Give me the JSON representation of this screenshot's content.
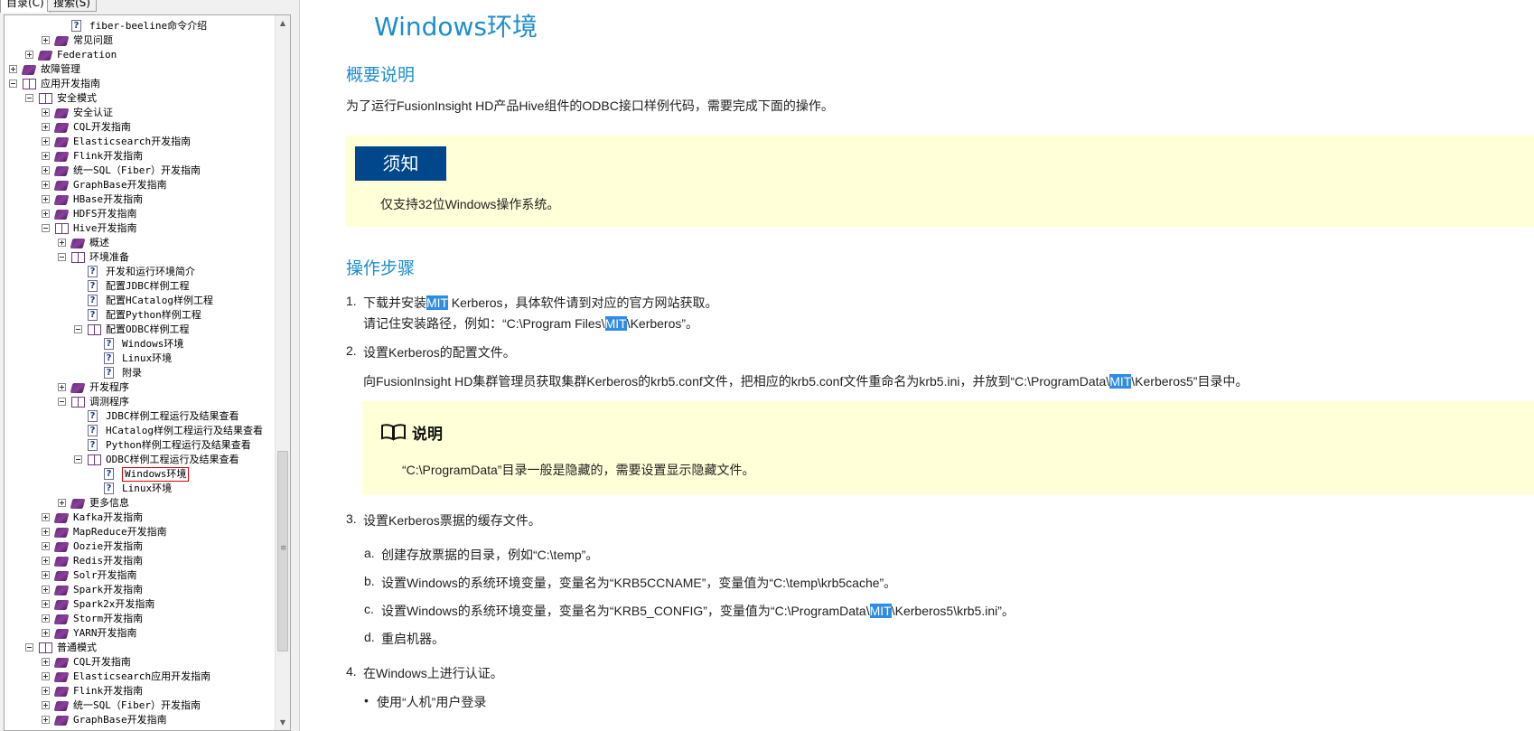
{
  "tabs": {
    "contents": "目录(C)",
    "search": "搜索(S)"
  },
  "tree": [
    {
      "label": "fiber-beeline命令介绍",
      "level": 3,
      "icon": "page",
      "exp": ""
    },
    {
      "label": "常见问题",
      "level": 2,
      "icon": "book",
      "exp": "plus"
    },
    {
      "label": "Federation",
      "level": 1,
      "icon": "book",
      "exp": "plus"
    },
    {
      "label": "故障管理",
      "level": 0,
      "icon": "book",
      "exp": "plus"
    },
    {
      "label": "应用开发指南",
      "level": 0,
      "icon": "book-open",
      "exp": "minus"
    },
    {
      "label": "安全模式",
      "level": 1,
      "icon": "book-open",
      "exp": "minus"
    },
    {
      "label": "安全认证",
      "level": 2,
      "icon": "book",
      "exp": "plus"
    },
    {
      "label": "CQL开发指南",
      "level": 2,
      "icon": "book",
      "exp": "plus"
    },
    {
      "label": "Elasticsearch开发指南",
      "level": 2,
      "icon": "book",
      "exp": "plus"
    },
    {
      "label": "Flink开发指南",
      "level": 2,
      "icon": "book",
      "exp": "plus"
    },
    {
      "label": "统一SQL（Fiber）开发指南",
      "level": 2,
      "icon": "book",
      "exp": "plus"
    },
    {
      "label": "GraphBase开发指南",
      "level": 2,
      "icon": "book",
      "exp": "plus"
    },
    {
      "label": "HBase开发指南",
      "level": 2,
      "icon": "book",
      "exp": "plus"
    },
    {
      "label": "HDFS开发指南",
      "level": 2,
      "icon": "book",
      "exp": "plus"
    },
    {
      "label": "Hive开发指南",
      "level": 2,
      "icon": "book-open",
      "exp": "minus"
    },
    {
      "label": "概述",
      "level": 3,
      "icon": "book",
      "exp": "plus"
    },
    {
      "label": "环境准备",
      "level": 3,
      "icon": "book-open",
      "exp": "minus"
    },
    {
      "label": "开发和运行环境简介",
      "level": 4,
      "icon": "page",
      "exp": ""
    },
    {
      "label": "配置JDBC样例工程",
      "level": 4,
      "icon": "page",
      "exp": ""
    },
    {
      "label": "配置HCatalog样例工程",
      "level": 4,
      "icon": "page",
      "exp": ""
    },
    {
      "label": "配置Python样例工程",
      "level": 4,
      "icon": "page",
      "exp": ""
    },
    {
      "label": "配置ODBC样例工程",
      "level": 4,
      "icon": "book-open",
      "exp": "minus"
    },
    {
      "label": "Windows环境",
      "level": 5,
      "icon": "page",
      "exp": ""
    },
    {
      "label": "Linux环境",
      "level": 5,
      "icon": "page",
      "exp": ""
    },
    {
      "label": "附录",
      "level": 5,
      "icon": "page",
      "exp": ""
    },
    {
      "label": "开发程序",
      "level": 3,
      "icon": "book",
      "exp": "plus"
    },
    {
      "label": "调测程序",
      "level": 3,
      "icon": "book-open",
      "exp": "minus"
    },
    {
      "label": "JDBC样例工程运行及结果查看",
      "level": 4,
      "icon": "page",
      "exp": ""
    },
    {
      "label": "HCatalog样例工程运行及结果查看",
      "level": 4,
      "icon": "page",
      "exp": ""
    },
    {
      "label": "Python样例工程运行及结果查看",
      "level": 4,
      "icon": "page",
      "exp": ""
    },
    {
      "label": "ODBC样例工程运行及结果查看",
      "level": 4,
      "icon": "book-open",
      "exp": "minus"
    },
    {
      "label": "Windows环境",
      "level": 5,
      "icon": "page",
      "exp": "",
      "selected": true
    },
    {
      "label": "Linux环境",
      "level": 5,
      "icon": "page",
      "exp": ""
    },
    {
      "label": "更多信息",
      "level": 3,
      "icon": "book",
      "exp": "plus"
    },
    {
      "label": "Kafka开发指南",
      "level": 2,
      "icon": "book",
      "exp": "plus"
    },
    {
      "label": "MapReduce开发指南",
      "level": 2,
      "icon": "book",
      "exp": "plus"
    },
    {
      "label": "Oozie开发指南",
      "level": 2,
      "icon": "book",
      "exp": "plus"
    },
    {
      "label": "Redis开发指南",
      "level": 2,
      "icon": "book",
      "exp": "plus"
    },
    {
      "label": "Solr开发指南",
      "level": 2,
      "icon": "book",
      "exp": "plus"
    },
    {
      "label": "Spark开发指南",
      "level": 2,
      "icon": "book",
      "exp": "plus"
    },
    {
      "label": "Spark2x开发指南",
      "level": 2,
      "icon": "book",
      "exp": "plus"
    },
    {
      "label": "Storm开发指南",
      "level": 2,
      "icon": "book",
      "exp": "plus"
    },
    {
      "label": "YARN开发指南",
      "level": 2,
      "icon": "book",
      "exp": "plus"
    },
    {
      "label": "普通模式",
      "level": 1,
      "icon": "book-open",
      "exp": "minus"
    },
    {
      "label": "CQL开发指南",
      "level": 2,
      "icon": "book",
      "exp": "plus"
    },
    {
      "label": "Elasticsearch应用开发指南",
      "level": 2,
      "icon": "book",
      "exp": "plus"
    },
    {
      "label": "Flink开发指南",
      "level": 2,
      "icon": "book",
      "exp": "plus"
    },
    {
      "label": "统一SQL（Fiber）开发指南",
      "level": 2,
      "icon": "book",
      "exp": "plus"
    },
    {
      "label": "GraphBase开发指南",
      "level": 2,
      "icon": "book",
      "exp": "plus"
    }
  ],
  "doc": {
    "title": "Windows环境",
    "section1": "概要说明",
    "intro": "为了运行FusionInsight HD产品Hive组件的ODBC接口样例代码，需要完成下面的操作。",
    "notice_label": "须知",
    "notice_text": "仅支持32位Windows操作系统。",
    "section2": "操作步骤",
    "steps": {
      "s1_num": "1.",
      "s1_pre": "下载并安装",
      "s1_hl": "MIT",
      "s1_post": " Kerberos，具体软件请到对应的官方网站获取。",
      "s1_sub_pre": "请记住安装路径，例如：“C:\\Program Files\\",
      "s1_sub_hl": "MIT",
      "s1_sub_post": "\\Kerberos”。",
      "s2_num": "2.",
      "s2": "设置Kerberos的配置文件。",
      "s2_sub_pre": "向FusionInsight HD集群管理员获取集群Kerberos的krb5.conf文件，把相应的krb5.conf文件重命名为krb5.ini，并放到“C:\\ProgramData\\",
      "s2_sub_hl": "MIT",
      "s2_sub_post": "\\Kerberos5”目录中。",
      "note_heading": "说明",
      "note_text": "“C:\\ProgramData”目录一般是隐藏的，需要设置显示隐藏文件。",
      "s3_num": "3.",
      "s3": "设置Kerberos票据的缓存文件。",
      "a_num": "a.",
      "a": "创建存放票据的目录，例如“C:\\temp”。",
      "b_num": "b.",
      "b": "设置Windows的系统环境变量，变量名为“KRB5CCNAME”，变量值为“C:\\temp\\krb5cache”。",
      "c_num": "c.",
      "c_pre": "设置Windows的系统环境变量，变量名为“KRB5_CONFIG”，变量值为“C:\\ProgramData\\",
      "c_hl": "MIT",
      "c_post": "\\Kerberos5\\krb5.ini”。",
      "d_num": "d.",
      "d": "重启机器。",
      "s4_num": "4.",
      "s4": "在Windows上进行认证。",
      "bullet": "•",
      "bullet_text": "使用“人机”用户登录"
    }
  },
  "colors": {
    "accent": "#1c8ecf",
    "notice_bg": "#ffffd8",
    "notice_label": "#00488b",
    "highlight": "#2f8ce3",
    "book": "#7a3590"
  }
}
